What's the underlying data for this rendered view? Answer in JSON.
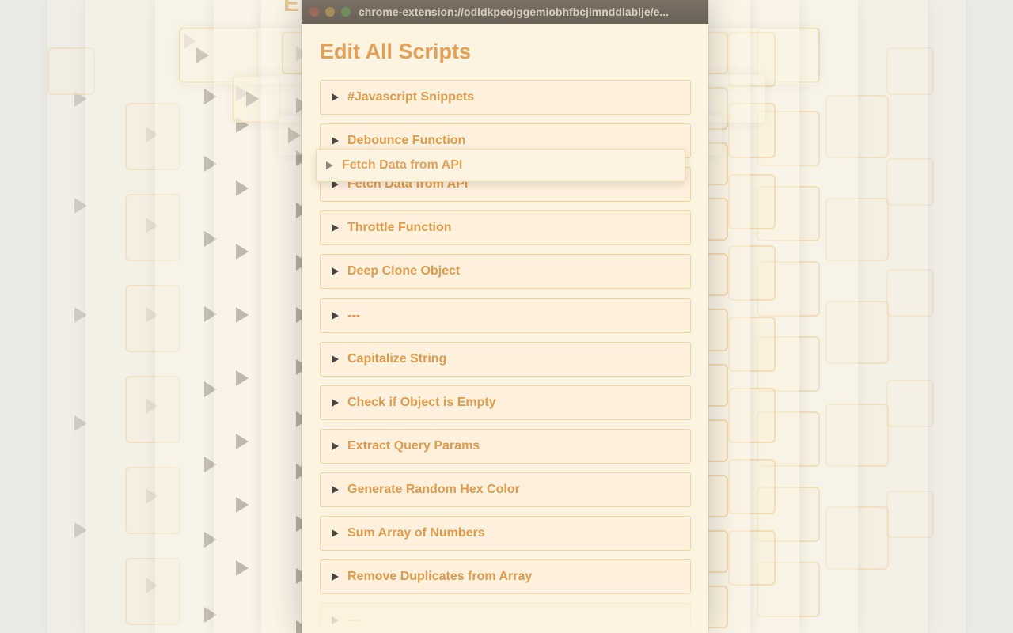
{
  "window": {
    "url": "chrome-extension://odldkpeojggemiobhfbcjlmnddlablje/e..."
  },
  "page": {
    "title": "Edit All Scripts"
  },
  "scripts": [
    {
      "label": "#Javascript Snippets"
    },
    {
      "label": "Debounce Function"
    },
    {
      "label": "Fetch Data from API"
    },
    {
      "label": "Throttle Function"
    },
    {
      "label": "Deep Clone Object"
    },
    {
      "label": "---"
    },
    {
      "label": "Capitalize String"
    },
    {
      "label": "Check if Object is Empty"
    },
    {
      "label": "Extract Query Params"
    },
    {
      "label": "Generate Random Hex Color"
    },
    {
      "label": "Sum Array of Numbers"
    },
    {
      "label": "Remove Duplicates from Array"
    },
    {
      "label": "---"
    }
  ],
  "drag_item": {
    "label": "Fetch Data from API"
  },
  "colors": {
    "accent": "#df9a4b",
    "item_border": "#f2d49e",
    "item_bg": "#fdf0dc",
    "window_bg": "#fcf3e1"
  }
}
